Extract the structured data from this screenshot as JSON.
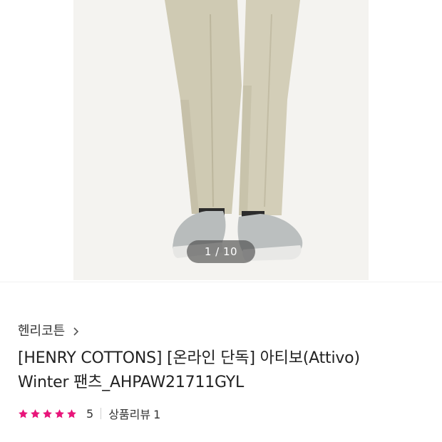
{
  "gallery": {
    "counter": "1 / 10",
    "current": 1,
    "total": 10
  },
  "product": {
    "brand": "헨리코튼",
    "title_line1": "[HENRY COTTONS] [온라인 단독] 아티보(Attivo)",
    "title_line2": "Winter 팬츠_AHPAW21711GYL",
    "rating_value": 5,
    "rating_score": "5",
    "review_label": "상품리뷰",
    "review_count": "1"
  },
  "colors": {
    "star": "#e8157a",
    "pants": "#cdc8b2",
    "shoes": "#b9bdbd"
  },
  "icons": {
    "brand_arrow": "chevron-right-icon",
    "star": "star-icon"
  }
}
